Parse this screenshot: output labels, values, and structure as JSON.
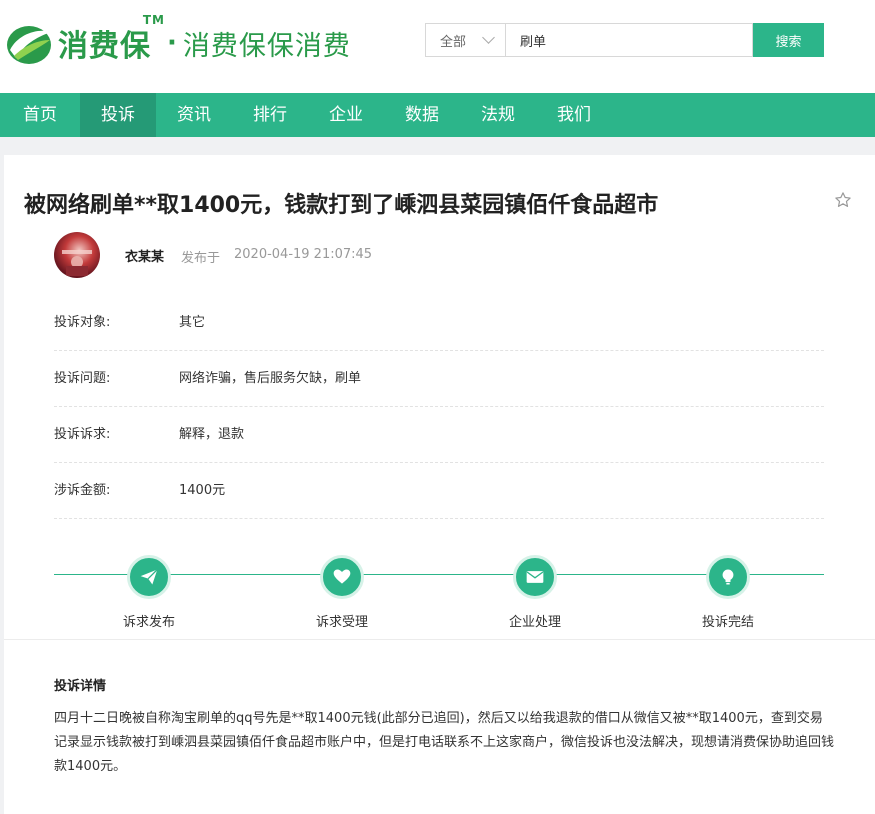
{
  "header": {
    "brand": "消费保",
    "tm": "TM",
    "dot": "·",
    "slogan": "消费保保消费",
    "search": {
      "scope": "全部",
      "value": "刷单",
      "button": "搜索"
    }
  },
  "nav": {
    "items": [
      {
        "label": "首页",
        "active": false
      },
      {
        "label": "投诉",
        "active": true
      },
      {
        "label": "资讯",
        "active": false
      },
      {
        "label": "排行",
        "active": false
      },
      {
        "label": "企业",
        "active": false
      },
      {
        "label": "数据",
        "active": false
      },
      {
        "label": "法规",
        "active": false
      },
      {
        "label": "我们",
        "active": false
      }
    ]
  },
  "complaint": {
    "title": "被网络刷单**取1400元，钱款打到了嵊泗县菜园镇佰仟食品超市",
    "author": "衣某某",
    "published_label": "发布于",
    "published_time": "2020-04-19 21:07:45",
    "fields": [
      {
        "label": "投诉对象:",
        "value": "其它"
      },
      {
        "label": "投诉问题:",
        "value": "网络诈骗，售后服务欠缺，刷单"
      },
      {
        "label": "投诉诉求:",
        "value": "解释，退款"
      },
      {
        "label": "涉诉金额:",
        "value": "1400元"
      }
    ],
    "steps": [
      {
        "label": "诉求发布",
        "icon": "paper-plane-icon"
      },
      {
        "label": "诉求受理",
        "icon": "heart-icon"
      },
      {
        "label": "企业处理",
        "icon": "mail-icon"
      },
      {
        "label": "投诉完结",
        "icon": "lightbulb-icon"
      }
    ],
    "detail_title": "投诉详情",
    "detail_text": "四月十二日晚被自称淘宝刷单的qq号先是**取1400元钱(此部分已追回)，然后又以给我退款的借口从微信又被**取1400元，查到交易记录显示钱款被打到嵊泗县菜园镇佰仟食品超市账户中，但是打电话联系不上这家商户，微信投诉也没法解决，现想请消费保协助追回钱款1400元。"
  },
  "colors": {
    "brand_green": "#2a9a4a",
    "accent": "#2cb58a",
    "nav_active": "#259a76"
  }
}
